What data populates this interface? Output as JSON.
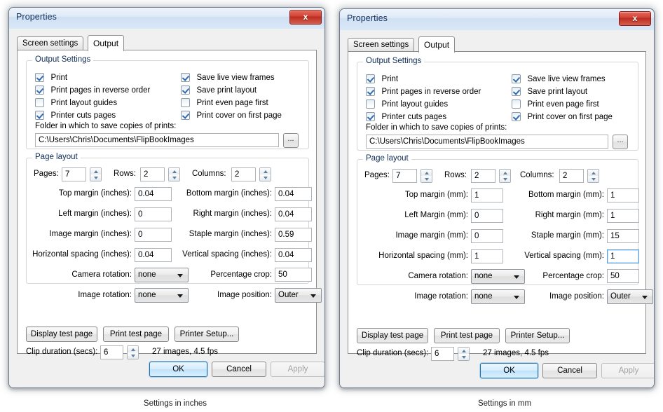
{
  "captions": {
    "left": "Settings in inches",
    "right": "Settings in mm"
  },
  "dialogs": [
    {
      "id": "inches",
      "title": "Properties",
      "close_label": "x",
      "tabs": [
        {
          "label": "Screen settings",
          "active": false
        },
        {
          "label": "Output",
          "active": true
        }
      ],
      "output_settings": {
        "group_label": "Output Settings",
        "checkboxes_left": [
          {
            "label": "Print",
            "checked": true
          },
          {
            "label": "Print pages in reverse order",
            "checked": true
          },
          {
            "label": "Print layout guides",
            "checked": false
          },
          {
            "label": "Printer cuts pages",
            "checked": true
          }
        ],
        "checkboxes_right": [
          {
            "label": "Save live view frames",
            "checked": true
          },
          {
            "label": "Save print layout",
            "checked": true
          },
          {
            "label": "Print even page first",
            "checked": false
          },
          {
            "label": "Print cover on first page",
            "checked": true
          }
        ],
        "folder_label": "Folder in which to save copies of prints:",
        "folder_value": "C:\\Users\\Chris\\Documents\\FlipBookImages",
        "browse_label": "..."
      },
      "page_layout": {
        "group_label": "Page layout",
        "pages_label": "Pages:",
        "pages_value": "7",
        "rows_label": "Rows:",
        "rows_value": "2",
        "columns_label": "Columns:",
        "columns_value": "2",
        "fields": [
          {
            "label": "Top margin (inches):",
            "value": "0.04",
            "focus": false
          },
          {
            "label": "Bottom margin (inches):",
            "value": "0.04",
            "focus": false
          },
          {
            "label": "Left margin (inches):",
            "value": "0",
            "focus": false
          },
          {
            "label": "Right margin (inches):",
            "value": "0.04",
            "focus": false
          },
          {
            "label": "Image margin (inches):",
            "value": "0",
            "focus": false
          },
          {
            "label": "Staple margin (inches):",
            "value": "0.59",
            "focus": false
          },
          {
            "label": "Horizontal spacing (inches):",
            "value": "0.04",
            "focus": false
          },
          {
            "label": "Vertical spacing (inches):",
            "value": "0.04",
            "focus": false
          }
        ],
        "camera_rotation_label": "Camera rotation:",
        "camera_rotation_value": "none",
        "percentage_crop_label": "Percentage crop:",
        "percentage_crop_value": "50",
        "image_rotation_label": "Image rotation:",
        "image_rotation_value": "none",
        "image_position_label": "Image position:",
        "image_position_value": "Outer"
      },
      "actions": {
        "display_test_page": "Display test page",
        "print_test_page": "Print test page",
        "printer_setup": "Printer Setup...",
        "clip_duration_label": "Clip duration (secs):",
        "clip_duration_value": "6",
        "info": "27 images, 4.5 fps"
      },
      "buttons": {
        "ok": "OK",
        "cancel": "Cancel",
        "apply": "Apply"
      }
    },
    {
      "id": "mm",
      "title": "Properties",
      "close_label": "x",
      "tabs": [
        {
          "label": "Screen settings",
          "active": false
        },
        {
          "label": "Output",
          "active": true
        }
      ],
      "output_settings": {
        "group_label": "Output Settings",
        "checkboxes_left": [
          {
            "label": "Print",
            "checked": true
          },
          {
            "label": "Print pages in reverse order",
            "checked": true
          },
          {
            "label": "Print layout guides",
            "checked": false
          },
          {
            "label": "Printer cuts pages",
            "checked": true
          }
        ],
        "checkboxes_right": [
          {
            "label": "Save live view frames",
            "checked": true
          },
          {
            "label": "Save print layout",
            "checked": true
          },
          {
            "label": "Print even page first",
            "checked": false
          },
          {
            "label": "Print cover on first page",
            "checked": true
          }
        ],
        "folder_label": "Folder in which to save copies of prints:",
        "folder_value": "C:\\Users\\Chris\\Documents\\FlipBookImages",
        "browse_label": "..."
      },
      "page_layout": {
        "group_label": "Page layout",
        "pages_label": "Pages:",
        "pages_value": "7",
        "rows_label": "Rows:",
        "rows_value": "2",
        "columns_label": "Columns:",
        "columns_value": "2",
        "fields": [
          {
            "label": "Top margin (mm):",
            "value": "1",
            "focus": false
          },
          {
            "label": "Bottom margin (mm):",
            "value": "1",
            "focus": false
          },
          {
            "label": "Left Margin (mm):",
            "value": "0",
            "focus": false
          },
          {
            "label": "Right margin (mm):",
            "value": "1",
            "focus": false
          },
          {
            "label": "Image margin (mm):",
            "value": "0",
            "focus": false
          },
          {
            "label": "Staple margin (mm):",
            "value": "15",
            "focus": false
          },
          {
            "label": "Horizontal spacing (mm):",
            "value": "1",
            "focus": false
          },
          {
            "label": "Vertical spacing (mm):",
            "value": "1",
            "focus": true
          }
        ],
        "camera_rotation_label": "Camera rotation:",
        "camera_rotation_value": "none",
        "percentage_crop_label": "Percentage crop:",
        "percentage_crop_value": "50",
        "image_rotation_label": "Image rotation:",
        "image_rotation_value": "none",
        "image_position_label": "Image position:",
        "image_position_value": "Outer"
      },
      "actions": {
        "display_test_page": "Display test page",
        "print_test_page": "Print test page",
        "printer_setup": "Printer Setup...",
        "clip_duration_label": "Clip duration (secs):",
        "clip_duration_value": "6",
        "info": "27 images, 4.5 fps"
      },
      "buttons": {
        "ok": "OK",
        "cancel": "Cancel",
        "apply": "Apply"
      }
    }
  ],
  "colors": {
    "titlebar_accent": "#cfe0f3",
    "close_button": "#c8372a",
    "default_button_border": "#2c6ca1",
    "focus_border": "#5a9ddb",
    "checkmark": "#2e6bb0"
  }
}
